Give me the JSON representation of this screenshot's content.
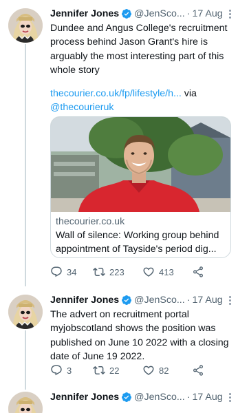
{
  "tweets": [
    {
      "author": "Jennifer Jones",
      "handle": "@JenSco...",
      "dot": "·",
      "time": "17 Aug",
      "text": "Dundee and Angus College's recruitment process behind Jason Grant's hire is arguably the most interesting part of this whole story",
      "link_text": "thecourier.co.uk/fp/lifestyle/h...",
      "via_text": " via",
      "via_handle": "@thecourieruk",
      "card": {
        "domain": "thecourier.co.uk",
        "title_line1": "Wall of silence: Working group behind",
        "title_line2": "appointment of Tayside's period dig..."
      },
      "replies": "34",
      "retweets": "223",
      "likes": "413"
    },
    {
      "author": "Jennifer Jones",
      "handle": "@JenSco...",
      "dot": "·",
      "time": "17 Aug",
      "text": "The advert on recruitment portal myjobscotland shows the position was published on June 10 2022 with a closing date of June 19 2022.",
      "replies": "3",
      "retweets": "22",
      "likes": "82"
    },
    {
      "author": "Jennifer Jones",
      "handle": "@JenSco...",
      "dot": "·",
      "time": "17 Aug"
    }
  ],
  "colors": {
    "accent": "#1d9bf0",
    "text": "#0f1419",
    "secondary": "#536471",
    "border": "#cfd9de"
  },
  "icons": [
    "verified-badge-icon",
    "more-icon",
    "reply-icon",
    "retweet-icon",
    "like-icon",
    "share-icon"
  ]
}
